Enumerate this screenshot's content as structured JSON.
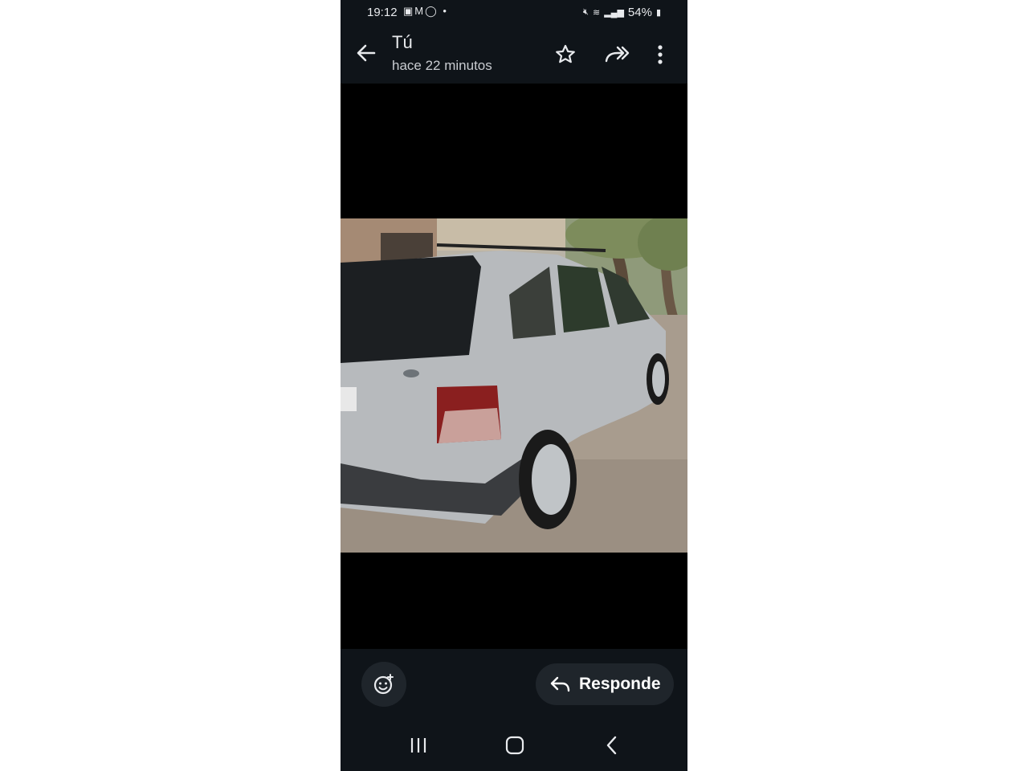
{
  "status_bar": {
    "time": "19:12",
    "battery": "54%",
    "notification_icons": [
      "image-icon",
      "gmail-icon",
      "whatsapp-icon",
      "dot-icon"
    ],
    "system_icons": [
      "mute-icon",
      "wifi-icon",
      "volte-icon",
      "signal-icon",
      "battery-icon"
    ]
  },
  "header": {
    "title": "Tú",
    "subtitle": "hace 22 minutos",
    "actions": [
      "back-arrow-icon",
      "star-icon",
      "forward-icon",
      "more-vert-icon"
    ]
  },
  "footer": {
    "reply_label": "Responde",
    "icons": [
      "add-reaction-icon",
      "reply-icon"
    ]
  },
  "nav_bar": {
    "icons": [
      "recents-icon",
      "home-icon",
      "back-icon"
    ]
  },
  "colors": {
    "bar_background": "#0f1419",
    "button_background": "#1f252b",
    "text": "#e8eaed",
    "viewer_background": "#000000"
  }
}
